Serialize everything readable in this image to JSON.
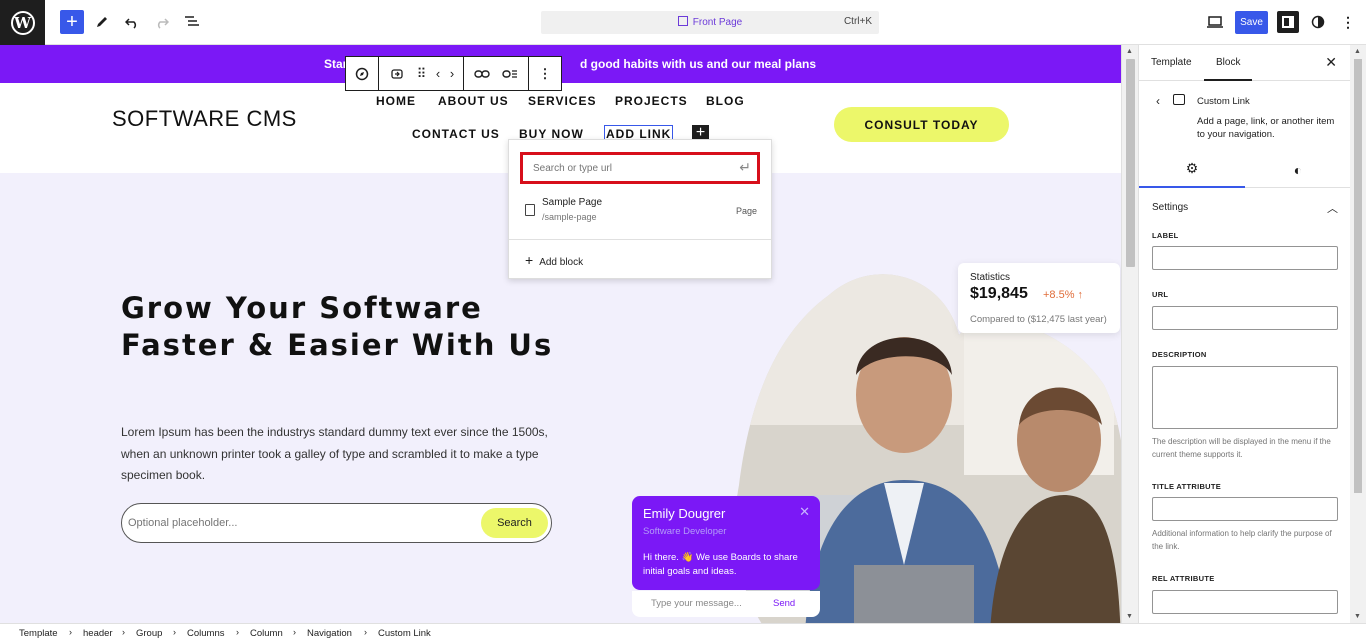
{
  "topbar": {
    "logo_letter": "W",
    "add_icon": "plus-icon",
    "tools_icon": "pencil-icon",
    "undo_icon": "undo-icon",
    "redo_icon": "redo-icon",
    "list_view_icon": "list-view-icon",
    "document_title": "Front Page",
    "shortcut": "Ctrl+K",
    "save_label": "Save",
    "accent": "#3858e9"
  },
  "site": {
    "promo_left": "Start",
    "promo_right": "d good habits with us and our meal plans",
    "title": "SOFTWARE CMS",
    "nav": [
      "HOME",
      "ABOUT US",
      "SERVICES",
      "PROJECTS",
      "BLOG",
      "CONTACT US",
      "BUY NOW",
      "ADD LINK"
    ],
    "nav_add_glyph": "+",
    "cta": "CONSULT TODAY",
    "hero_title": "Grow Your Software Faster & Easier with Us",
    "hero_desc": "Lorem Ipsum has been the industrys standard dummy text ever since the 1500s, when an unknown printer took a galley of type and scrambled it to make a type specimen book.",
    "search_placeholder": "Optional placeholder...",
    "search_button": "Search",
    "stats": {
      "label": "Statistics",
      "value": "$19,845",
      "growth": "+8.5%",
      "compared": "Compared to ($12,475 last year)"
    },
    "chat": {
      "name": "Emily Dougrer",
      "role": "Software Developer",
      "message": "Hi there. 👋 We use Boards to share initial goals and ideas.",
      "placeholder": "Type your message...",
      "send": "Send"
    },
    "brand_purple": "#7b18f6",
    "brand_yellow": "#ecf76a"
  },
  "link_popover": {
    "placeholder": "Search or type url",
    "suggestion_title": "Sample Page",
    "suggestion_url": "/sample-page",
    "suggestion_kind": "Page",
    "add_block": "Add block"
  },
  "sidebar": {
    "tabs": [
      "Template",
      "Block"
    ],
    "block_name": "Custom Link",
    "block_desc": "Add a page, link, or another item to your navigation.",
    "section": "Settings",
    "fields": {
      "label": "LABEL",
      "url": "URL",
      "description": "DESCRIPTION",
      "description_help": "The description will be displayed in the menu if the current theme supports it.",
      "title_attr": "TITLE ATTRIBUTE",
      "title_help": "Additional information to help clarify the purpose of the link.",
      "rel_attr": "REL ATTRIBUTE"
    }
  },
  "breadcrumb": [
    "Template",
    "header",
    "Group",
    "Columns",
    "Column",
    "Navigation",
    "Custom Link"
  ]
}
